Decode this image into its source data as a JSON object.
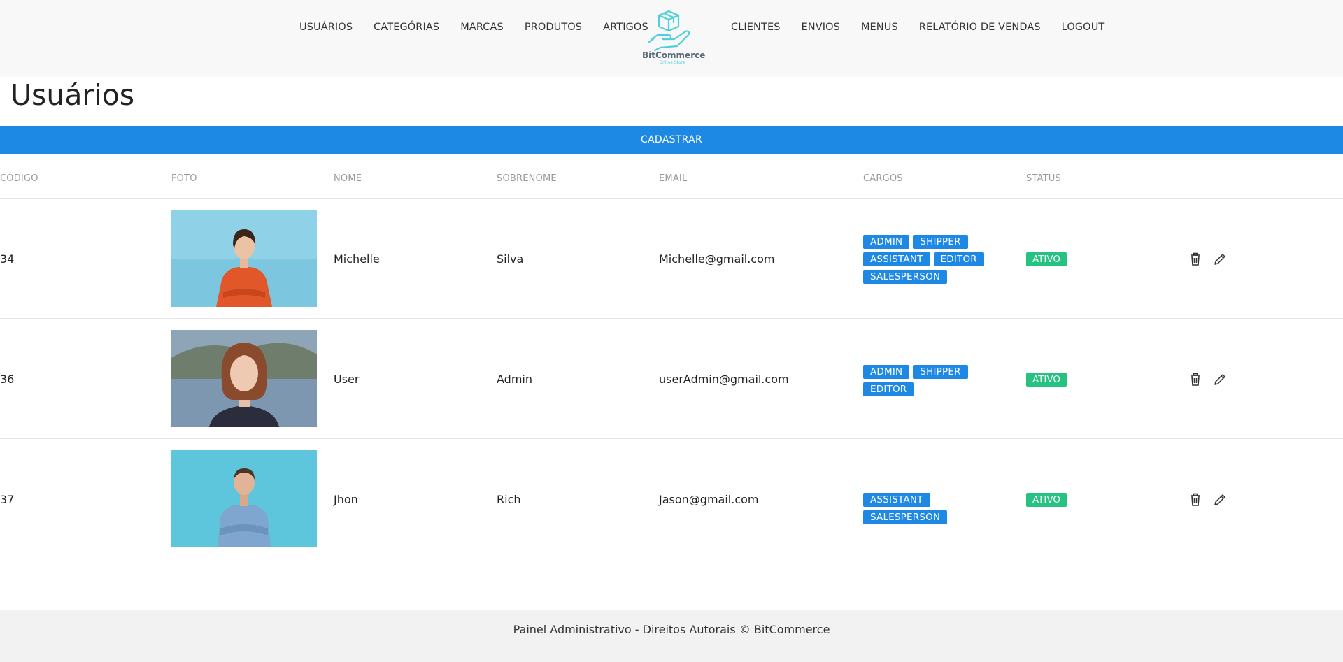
{
  "nav": {
    "left": [
      "USUÁRIOS",
      "CATEGÓRIAS",
      "MARCAS",
      "PRODUTOS",
      "ARTIGOS"
    ],
    "right": [
      "CLIENTES",
      "ENVIOS",
      "MENUS",
      "RELATÓRIO DE VENDAS",
      "LOGOUT"
    ]
  },
  "logo": {
    "name": "BitCommerce",
    "tagline": "Online Store",
    "icon": "hand-box-icon",
    "color": "#4fd1d9"
  },
  "page": {
    "title": "Usuários",
    "register_label": "CADASTRAR"
  },
  "table": {
    "headers": [
      "CÓDIGO",
      "FOTO",
      "NOME",
      "SOBRENOME",
      "EMAIL",
      "CARGOS",
      "STATUS"
    ],
    "rows": [
      {
        "code": "34",
        "photo": "woman-orange-shirt-photo",
        "first": "Michelle",
        "last": "Silva",
        "email": "Michelle@gmail.com",
        "roles": [
          "ADMIN",
          "SHIPPER",
          "ASSISTANT",
          "EDITOR",
          "SALESPERSON"
        ],
        "status": "ATIVO"
      },
      {
        "code": "36",
        "photo": "woman-lake-photo",
        "first": "User",
        "last": "Admin",
        "email": "userAdmin@gmail.com",
        "roles": [
          "ADMIN",
          "SHIPPER",
          "EDITOR"
        ],
        "status": "ATIVO"
      },
      {
        "code": "37",
        "photo": "man-blue-shirt-photo",
        "first": "Jhon",
        "last": "Rich",
        "email": "Jason@gmail.com",
        "roles": [
          "ASSISTANT",
          "SALESPERSON"
        ],
        "status": "ATIVO"
      }
    ]
  },
  "actions": {
    "delete_icon": "trash-icon",
    "edit_icon": "pencil-icon"
  },
  "footer": {
    "text": "Painel Administrativo - Direitos Autorais © BitCommerce"
  },
  "colors": {
    "primary": "#1e88e5",
    "status_active": "#26c281",
    "header_bg": "#f8f8f8"
  }
}
